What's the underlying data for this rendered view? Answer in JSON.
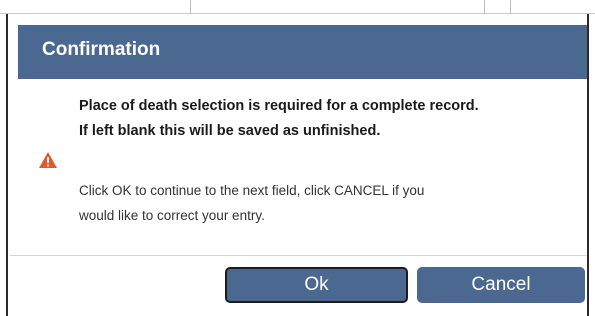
{
  "dialog": {
    "title": "Confirmation",
    "icon": "warning-icon",
    "icon_color": "#e8572a",
    "header_color": "#4a6890",
    "message_lines": [
      "Place of death selection is required for a complete record.",
      "If left blank this will be saved as unfinished."
    ],
    "note_lines": [
      "Click OK to continue to the next field, click CANCEL if you",
      "would like to correct your entry."
    ],
    "buttons": {
      "ok_label": "Ok",
      "cancel_label": "Cancel"
    }
  }
}
